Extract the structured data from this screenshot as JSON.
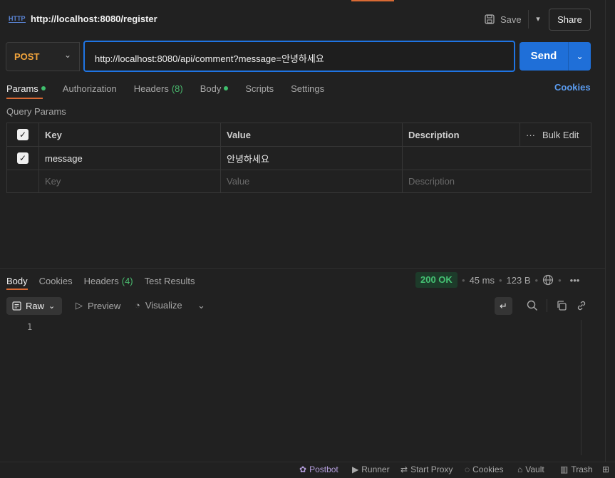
{
  "tab": {
    "icon": "http-icon",
    "icon_text": "HTTP",
    "title": "http://localhost:8080/register"
  },
  "toolbar": {
    "save_label": "Save",
    "share_label": "Share"
  },
  "request": {
    "method": "POST",
    "url": "http://localhost:8080/api/comment?message=안녕하세요",
    "send_label": "Send"
  },
  "request_tabs": [
    {
      "label": "Params",
      "dot": true,
      "active": true
    },
    {
      "label": "Authorization",
      "dot": false
    },
    {
      "label": "Headers",
      "count": "(8)"
    },
    {
      "label": "Body",
      "dot": true
    },
    {
      "label": "Scripts"
    },
    {
      "label": "Settings"
    }
  ],
  "cookies_link": "Cookies",
  "query_params": {
    "title": "Query Params",
    "headers": {
      "key": "Key",
      "value": "Value",
      "description": "Description",
      "bulk_edit": "Bulk Edit"
    },
    "rows": [
      {
        "checked": true,
        "key": "message",
        "value": "안녕하세요",
        "description": ""
      }
    ],
    "placeholder": {
      "key": "Key",
      "value": "Value",
      "description": "Description"
    }
  },
  "response_tabs": [
    {
      "label": "Body",
      "active": true
    },
    {
      "label": "Cookies"
    },
    {
      "label": "Headers",
      "count": "(4)"
    },
    {
      "label": "Test Results"
    }
  ],
  "response": {
    "status": "200 OK",
    "time": "45 ms",
    "size": "123 B",
    "status_color": "#45c173"
  },
  "view_modes": {
    "raw": "Raw",
    "preview": "Preview",
    "visualize": "Visualize"
  },
  "editor": {
    "line_numbers": [
      "1"
    ]
  },
  "footer": {
    "items": [
      {
        "label": "Postbot",
        "icon": "postbot-icon"
      },
      {
        "label": "Runner",
        "icon": "runner-icon"
      },
      {
        "label": "Start Proxy",
        "icon": "proxy-icon"
      },
      {
        "label": "Cookies",
        "icon": "cookie-icon"
      },
      {
        "label": "Vault",
        "icon": "vault-icon"
      },
      {
        "label": "Trash",
        "icon": "trash-icon"
      }
    ]
  },
  "colors": {
    "accent": "#d96a34",
    "primary_button": "#1f6fd8",
    "method_post": "#f2a43c",
    "link": "#5b9cf0"
  }
}
